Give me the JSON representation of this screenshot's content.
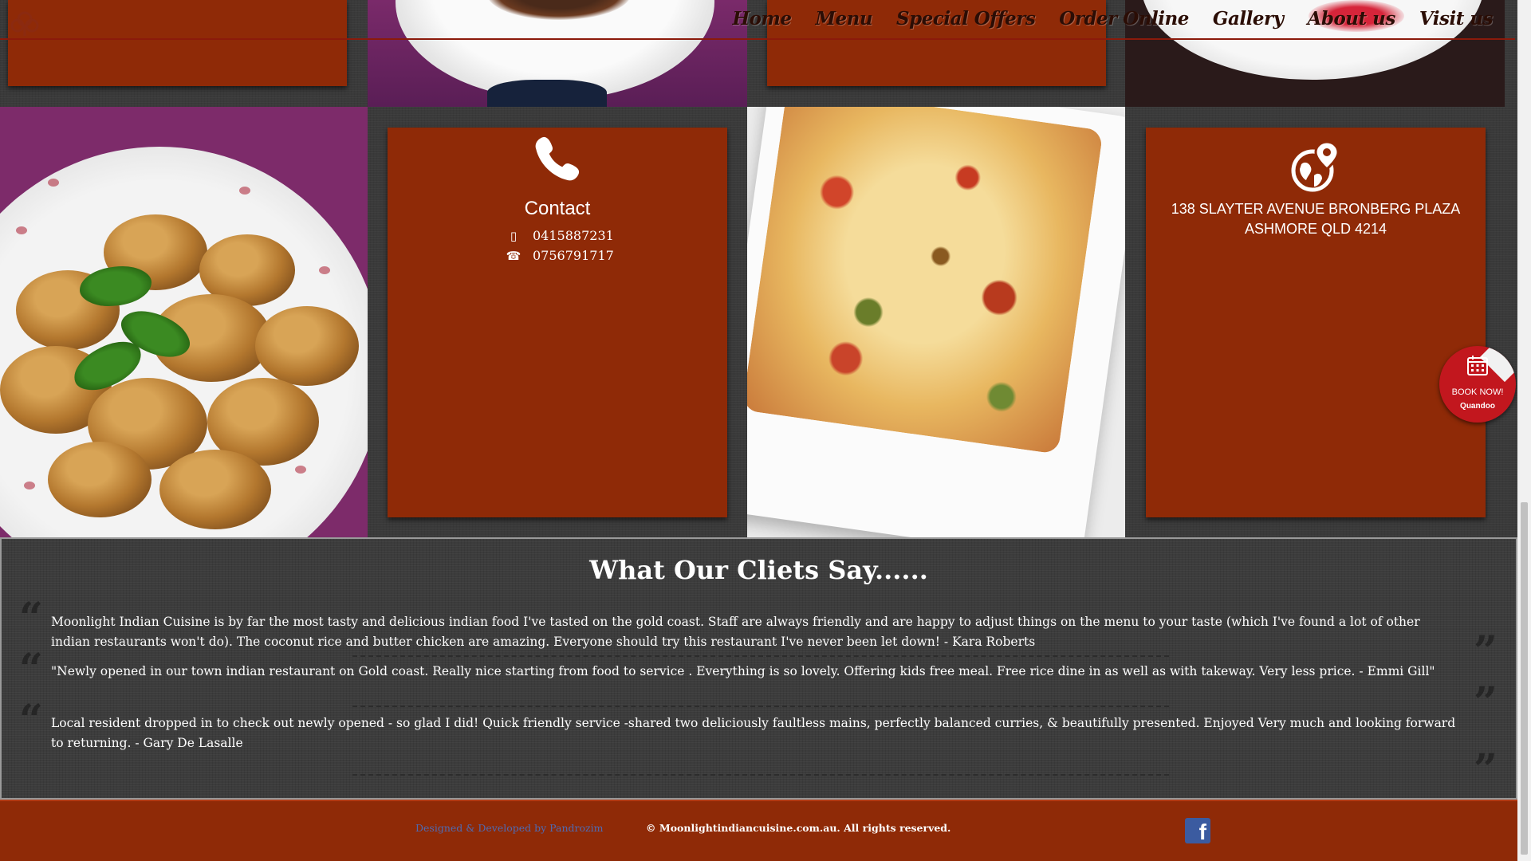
{
  "nav": {
    "items": [
      "Home",
      "Menu",
      "Special Offers",
      "Order Online",
      "Gallery",
      "About us",
      "Visit us"
    ]
  },
  "contact": {
    "title": "Contact",
    "mobile": "0415887231",
    "phone": "0756791717"
  },
  "address": {
    "line1": "138 SLAYTER AVENUE BRONBERG PLAZA",
    "line2": "ASHMORE QLD 4214"
  },
  "testimonials": {
    "title": "What Our Cliets Say......",
    "reviews": [
      "Moonlight Indian Cuisine is by far the most tasty and delicious indian food I've tasted on the gold coast. Staff are always friendly and are happy to adjust things on the menu to your taste (which I've found a lot of other indian restaurants won't do). The coconut rice and butter chicken are amazing. Everyone should try this restaurant I've never been let down! - Kara Roberts",
      "\"Newly opened in our town indian restaurant on Gold coast. Really nice starting from food to service . Everything is so lovely. Offering kids free meal. Free rice dine in as well as with takeway. Very less price. - Emmi Gill\"",
      "Local resident dropped in to check out newly opened - so glad I did! Quick friendly service -shared two deliciously faultless mains, perfectly balanced curries, & beautifully presented. Enjoyed Very much and looking forward to returning. - Gary De Lasalle"
    ]
  },
  "footer": {
    "credit": "Designed & Developed by Pandrozim",
    "copyright": "© Moonlightindiancuisine.com.au. All rights reserved.",
    "facebook_icon": "facebook-icon"
  },
  "booking": {
    "label": "BOOK NOW!",
    "brand": "Quandoo"
  },
  "colors": {
    "card": "#8f2a07",
    "footer": "#8f2a07",
    "nav_text": "#2b0d05",
    "credit_link": "#4f6ab2",
    "book_button": "#c2171e"
  }
}
